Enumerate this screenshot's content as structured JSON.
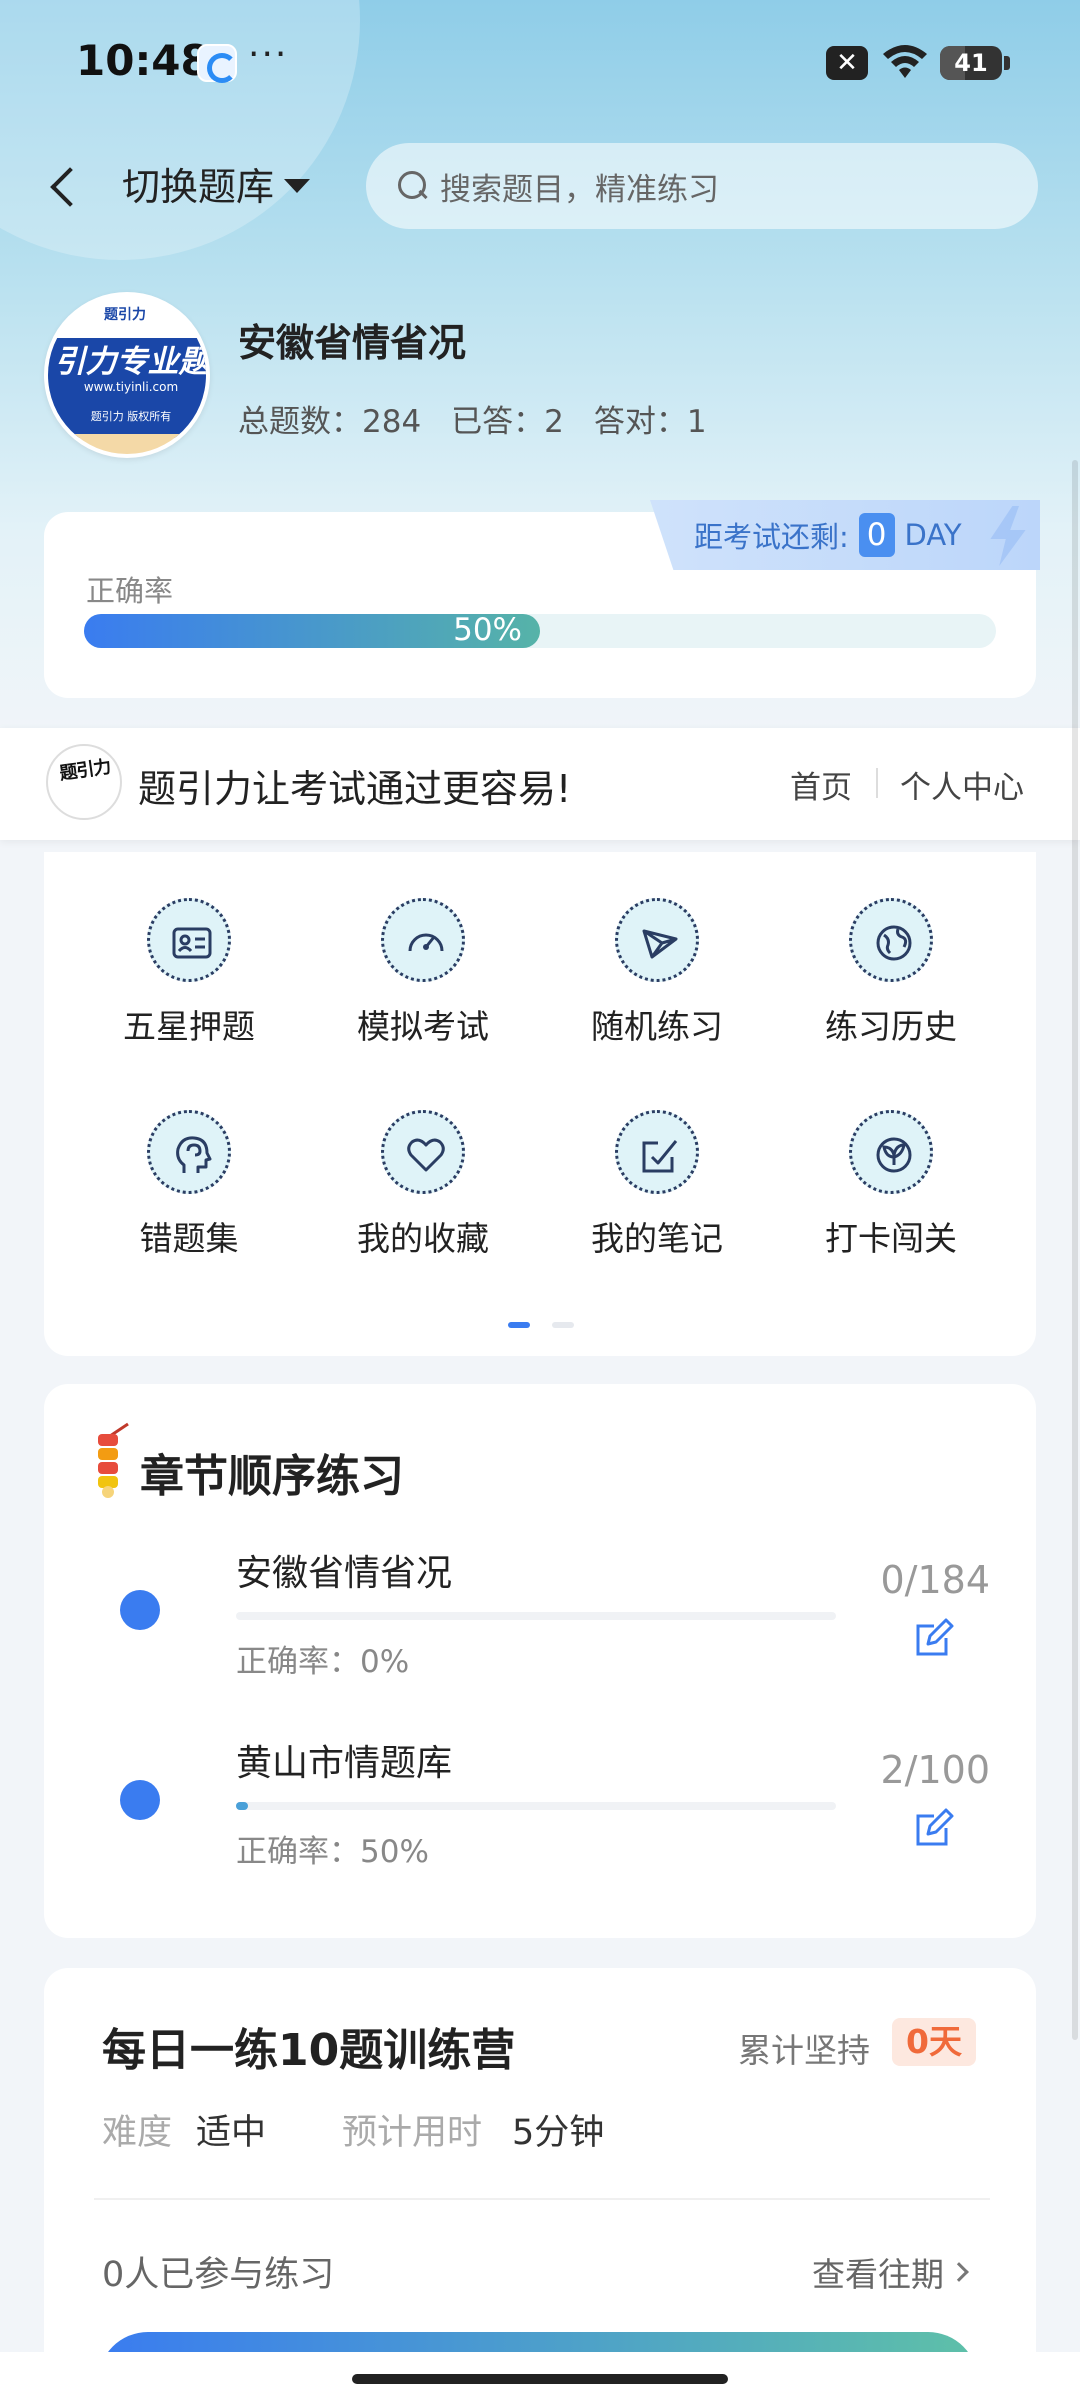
{
  "status_bar": {
    "time": "10:48",
    "more": "···",
    "sim": "✕",
    "battery": "41",
    "battery_level": 0.41
  },
  "nav": {
    "switch_label": "切换题库",
    "search_placeholder": "搜索题目，精准练习"
  },
  "profile": {
    "logo_main": "引力专业题",
    "logo_url": "www.tiyinli.com",
    "logo_copyright": "题引力 版权所有",
    "title": "安徽省情省况",
    "total_label": "总题数：284",
    "answered_label": "已答：2",
    "correct_label": "答对：1"
  },
  "accuracy": {
    "countdown_label": "距考试还剩:",
    "countdown_value": "0",
    "countdown_unit": "DAY",
    "label": "正确率",
    "percent_text": "50%",
    "value": 0.5
  },
  "banner": {
    "slogan": "题引力让考试通过更容易!",
    "home": "首页",
    "user_center": "个人中心"
  },
  "features": [
    {
      "label": "五星押题",
      "icon": "id-card-icon"
    },
    {
      "label": "模拟考试",
      "icon": "gauge-icon"
    },
    {
      "label": "随机练习",
      "icon": "shuffle-icon"
    },
    {
      "label": "练习历史",
      "icon": "globe-icon"
    },
    {
      "label": "错题集",
      "icon": "head-icon"
    },
    {
      "label": "我的收藏",
      "icon": "heart-icon"
    },
    {
      "label": "我的笔记",
      "icon": "note-icon"
    },
    {
      "label": "打卡闯关",
      "icon": "plant-icon"
    }
  ],
  "chapters": {
    "title": "章节顺序练习",
    "items": [
      {
        "name": "安徽省情省况",
        "accuracy": "正确率：0%",
        "count": "0/184",
        "progress": 0.0
      },
      {
        "name": "黄山市情题库",
        "accuracy": "正确率：50%",
        "count": "2/100",
        "progress": 0.02
      }
    ]
  },
  "daily": {
    "title": "每日一练10题训练营",
    "streak_label": "累计坚持",
    "streak_value": "0天",
    "difficulty_label": "难度",
    "difficulty_value": "适中",
    "time_label": "预计用时",
    "time_value": "5分钟",
    "participants": "0人已参与练习",
    "history_link": "查看往期"
  },
  "colors": {
    "accent": "#3a7cf0",
    "streak": "#f06a3a"
  }
}
